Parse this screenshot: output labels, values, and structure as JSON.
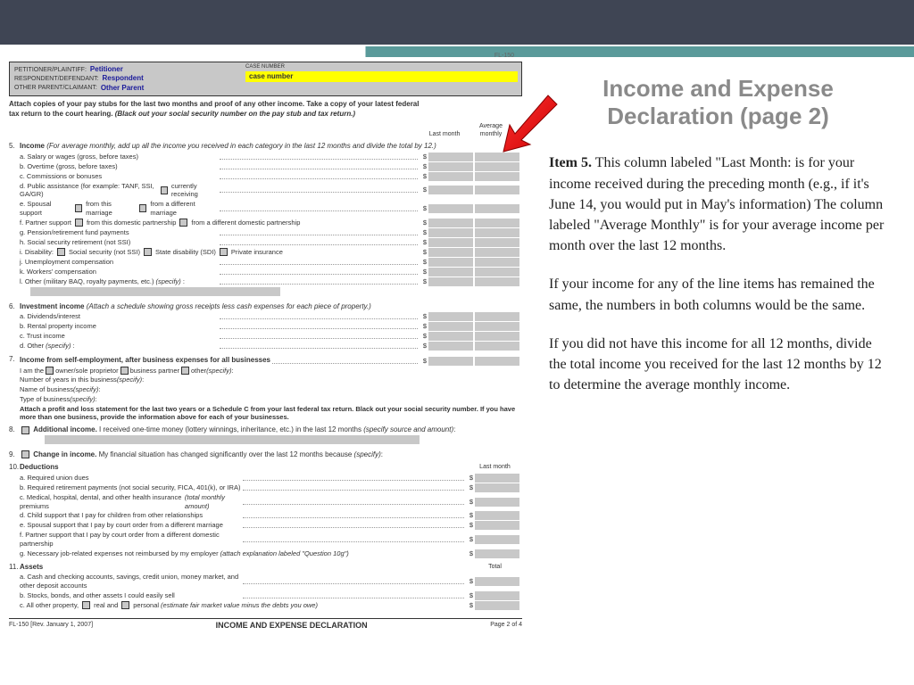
{
  "header": {
    "petitioner_label": "PETITIONER/PLAINTIFF:",
    "petitioner_val": "Petitioner",
    "respondent_label": "RESPONDENT/DEFENDANT:",
    "respondent_val": "Respondent",
    "other_label": "OTHER PARENT/CLAIMANT:",
    "other_val": "Other Parent",
    "case_label": "CASE NUMBER",
    "case_val": "case number",
    "form_code": "FL-150"
  },
  "instruction": {
    "line1": "Attach copies of your pay stubs for the last two months and proof of any other income. Take a copy of your latest federal",
    "line2": "tax return to the court hearing.",
    "ital": "(Black out your social security number on the pay stub and tax return.)"
  },
  "cols": {
    "last": "Last month",
    "avg": "Average monthly"
  },
  "sec5": {
    "num": "5.",
    "title": "Income",
    "ital": "(For average monthly, add up all the income you received in each category in the last 12 months and divide the total by 12.)",
    "items": {
      "a": "a.  Salary or wages (gross, before taxes)",
      "b": "b.  Overtime (gross, before taxes)",
      "c": "c.  Commissions or bonuses",
      "d": "d.  Public assistance (for example: TANF, SSI, GA/GR)",
      "d_chk": "currently receiving",
      "e": "e.  Spousal support",
      "e1": "from this marriage",
      "e2": "from a different marriage",
      "f": "f.  Partner support",
      "f1": "from this domestic partnership",
      "f2": "from a different domestic partnership",
      "g": "g.  Pension/retirement fund payments",
      "h": "h.  Social security retirement (not SSI)",
      "i": "i.  Disability:",
      "i1": "Social security (not SSI)",
      "i2": "State disability (SDI)",
      "i3": "Private insurance",
      "j": "j.  Unemployment compensation",
      "k": "k.  Workers' compensation",
      "l": "l.  Other (military BAQ, royalty payments, etc.)",
      "l_spec": "(specify)"
    }
  },
  "sec6": {
    "num": "6.",
    "title": "Investment income",
    "ital": "(Attach a schedule showing gross receipts less cash expenses for each piece of property.)",
    "a": "a.  Dividends/interest",
    "b": "b.  Rental property income",
    "c": "c.  Trust income",
    "d": "d.  Other",
    "d_spec": "(specify)"
  },
  "sec7": {
    "num": "7.",
    "title": "Income from self-employment, after business expenses for all businesses",
    "iam": "I am the",
    "o1": "owner/sole proprietor",
    "o2": "business partner",
    "o3": "other",
    "spec": "(specify)",
    "years": "Number of years in this business",
    "name": "Name of business",
    "type": "Type of business",
    "attach": "Attach a profit and loss statement for the last two years or a Schedule C from your last federal tax return. Black out your social security number. If you have more than one business, provide the information above for each of your businesses."
  },
  "sec8": {
    "num": "8.",
    "title": "Additional income.",
    "text": "I received one-time money (lottery winnings, inheritance, etc.) in the last 12 months",
    "spec": "(specify source and amount)"
  },
  "sec9": {
    "num": "9.",
    "title": "Change in income.",
    "text": "My financial situation has changed significantly over the last 12 months because",
    "spec": "(specify)"
  },
  "sec10": {
    "num": "10.",
    "title": "Deductions",
    "col": "Last month",
    "a": "a.  Required union dues",
    "b": "b.  Required retirement payments (not social security, FICA, 401(k), or IRA)",
    "c_pre": "c.  Medical, hospital, dental, and other health insurance premiums",
    "c_ital": "(total monthly amount)",
    "d": "d.  Child support that I pay for children from other relationships",
    "e": "e.  Spousal support that I pay by court order from a different marriage",
    "f": "f.  Partner support that I pay by court order from a different domestic partnership",
    "g_pre": "g.  Necessary job-related expenses not reimbursed by my employer",
    "g_ital": "(attach explanation labeled \"Question 10g\")"
  },
  "sec11": {
    "num": "11.",
    "title": "Assets",
    "col": "Total",
    "a": "a.  Cash and checking accounts, savings, credit union, money market, and other deposit accounts",
    "b": "b.  Stocks, bonds, and other assets I could easily sell",
    "c": "c.  All other property,",
    "c1": "real and",
    "c2": "personal",
    "c_ital": "(estimate fair market value minus the debts you owe)"
  },
  "footer": {
    "rev": "FL-150 [Rev. January 1, 2007]",
    "title": "INCOME AND EXPENSE DECLARATION",
    "page": "Page 2 of 4"
  },
  "info": {
    "title": "Income and Expense Declaration (page 2)",
    "p1_bold": "Item 5.",
    "p1": "  This column labeled \"Last Month: is for your income received during the preceding month (e.g., if it's June 14, you would put in May's information)  The column labeled \"Average Monthly\" is for your average income per month over the last 12 months.",
    "p2": "If your income for any of the line items has remained the same, the numbers in both columns would be the same.",
    "p3": "If you did not have this income for all 12 months, divide the total income you received for the last 12 months by 12 to determine the average monthly income."
  }
}
